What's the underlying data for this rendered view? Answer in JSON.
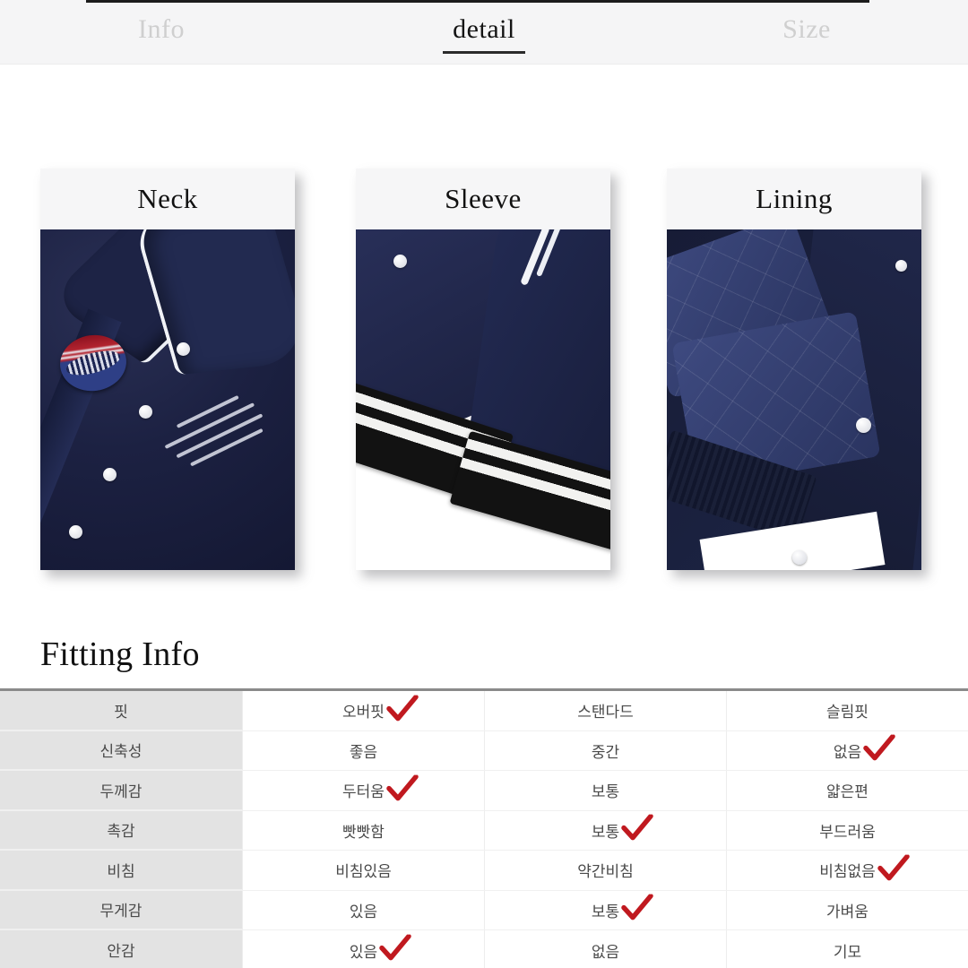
{
  "header": {
    "tabs": [
      {
        "label": "Info",
        "active": false
      },
      {
        "label": "detail",
        "active": true
      },
      {
        "label": "Size",
        "active": false
      }
    ]
  },
  "detail_cards": [
    {
      "title": "Neck",
      "photo": "navy-varsity-jacket-collar-with-white-piping-and-champions-patch"
    },
    {
      "title": "Sleeve",
      "photo": "navy-jacket-sleeve-with-black-and-white-striped-ribbed-cuff"
    },
    {
      "title": "Lining",
      "photo": "navy-quilted-diamond-lining-with-snap-buttons"
    }
  ],
  "fitting": {
    "heading": "Fitting Info",
    "rows": [
      {
        "label": "핏",
        "options": [
          {
            "text": "오버핏",
            "checked": true
          },
          {
            "text": "스탠다드",
            "checked": false
          },
          {
            "text": "슬림핏",
            "checked": false
          }
        ]
      },
      {
        "label": "신축성",
        "options": [
          {
            "text": "좋음",
            "checked": false
          },
          {
            "text": "중간",
            "checked": false
          },
          {
            "text": "없음",
            "checked": true
          }
        ]
      },
      {
        "label": "두께감",
        "options": [
          {
            "text": "두터움",
            "checked": true
          },
          {
            "text": "보통",
            "checked": false
          },
          {
            "text": "얇은편",
            "checked": false
          }
        ]
      },
      {
        "label": "촉감",
        "options": [
          {
            "text": "빳빳함",
            "checked": false
          },
          {
            "text": "보통",
            "checked": true
          },
          {
            "text": "부드러움",
            "checked": false
          }
        ]
      },
      {
        "label": "비침",
        "options": [
          {
            "text": "비침있음",
            "checked": false
          },
          {
            "text": "약간비침",
            "checked": false
          },
          {
            "text": "비침없음",
            "checked": true
          }
        ]
      },
      {
        "label": "무게감",
        "options": [
          {
            "text": "있음",
            "checked": false
          },
          {
            "text": "보통",
            "checked": true
          },
          {
            "text": "가벼움",
            "checked": false
          }
        ]
      },
      {
        "label": "안감",
        "options": [
          {
            "text": "있음",
            "checked": true
          },
          {
            "text": "없음",
            "checked": false
          },
          {
            "text": "기모",
            "checked": false
          }
        ]
      }
    ]
  },
  "colors": {
    "check_red": "#c0191f",
    "tab_active": "#141414",
    "tab_inactive": "#cfcfcf",
    "table_label_bg": "#e3e3e3",
    "garment_navy": "#1d2345"
  }
}
